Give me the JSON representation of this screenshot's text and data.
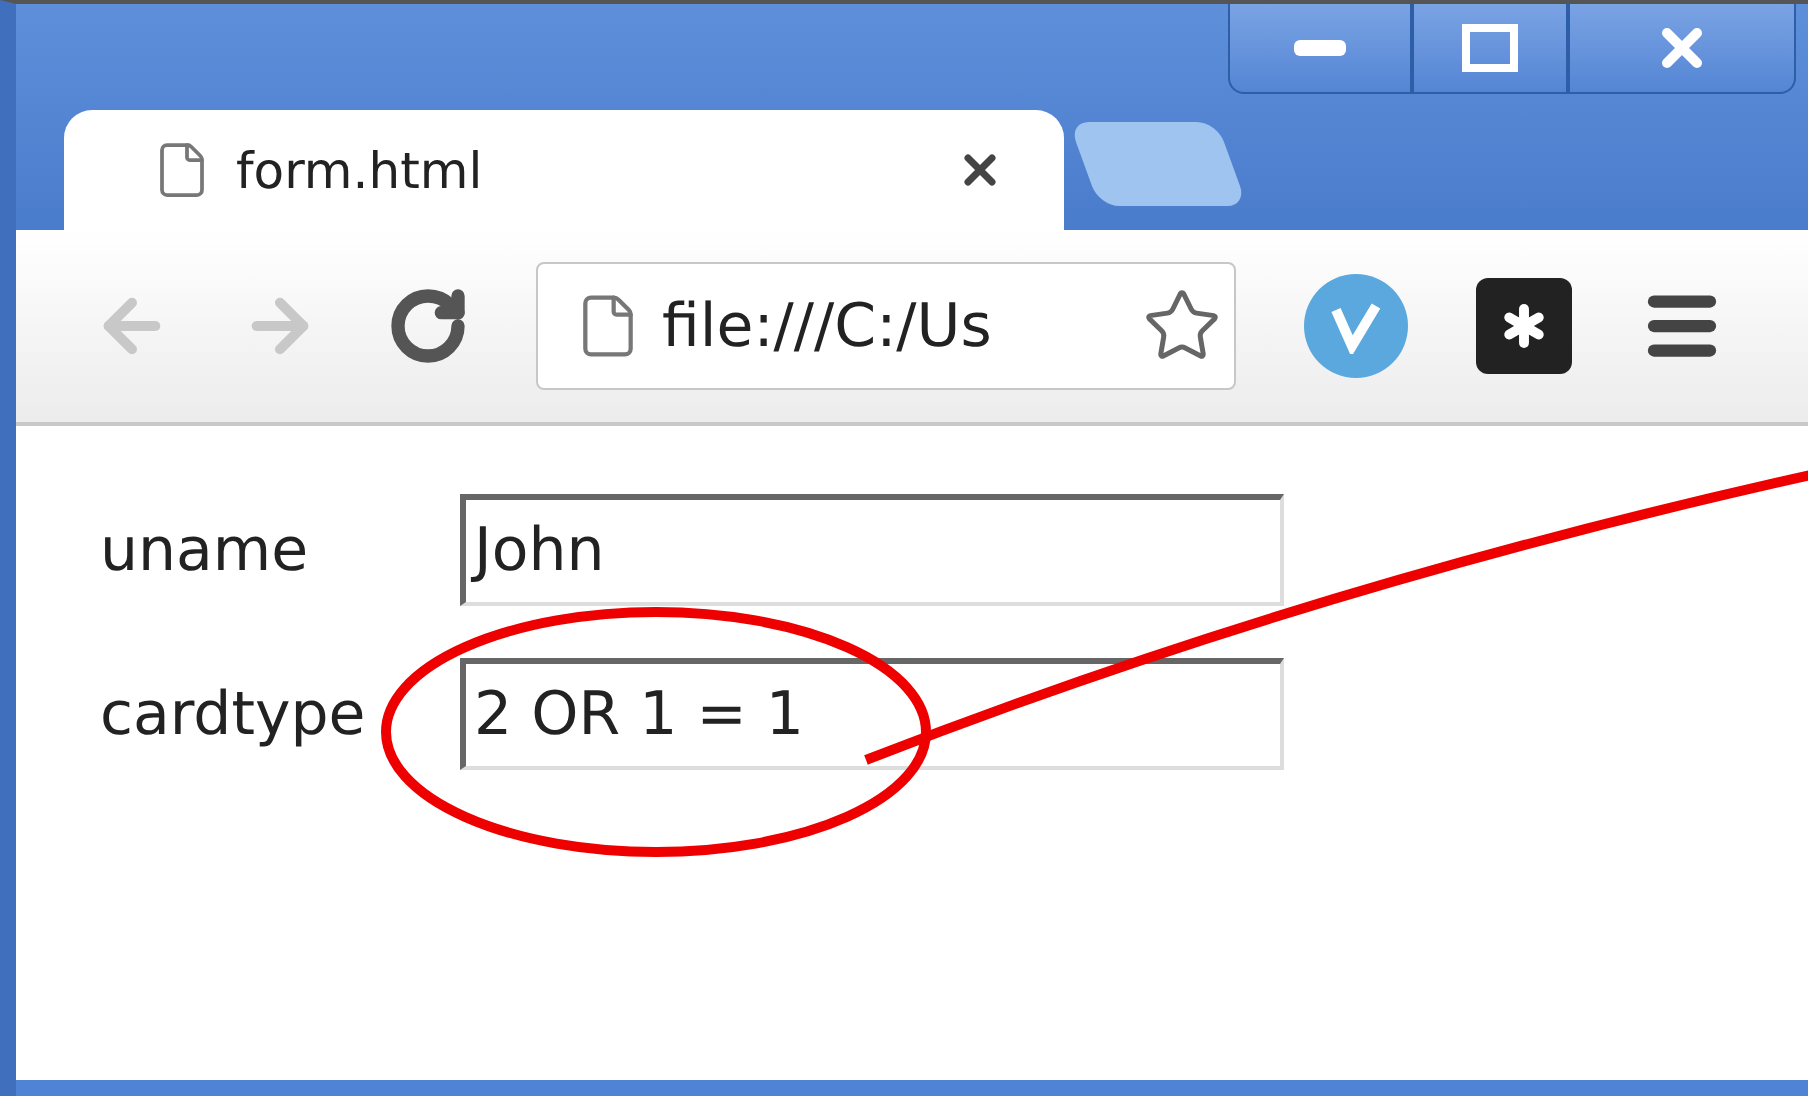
{
  "window": {
    "controls": [
      {
        "kind": "minimize"
      },
      {
        "kind": "restore"
      },
      {
        "kind": "close"
      }
    ]
  },
  "tabs": [
    {
      "kind": "page",
      "title": "form.html",
      "selected": true
    },
    {
      "kind": "new",
      "selected": false
    }
  ],
  "toolbar": {
    "back_disabled": true,
    "forward_disabled": true,
    "address": "file:///C:/Us"
  },
  "form": {
    "fields": [
      {
        "label": "uname",
        "value": "John"
      },
      {
        "label": "cardtype",
        "value": "2 OR 1 = 1"
      }
    ]
  },
  "annotation": {
    "kind": "circle-with-arrow",
    "color": "#ee0000"
  }
}
